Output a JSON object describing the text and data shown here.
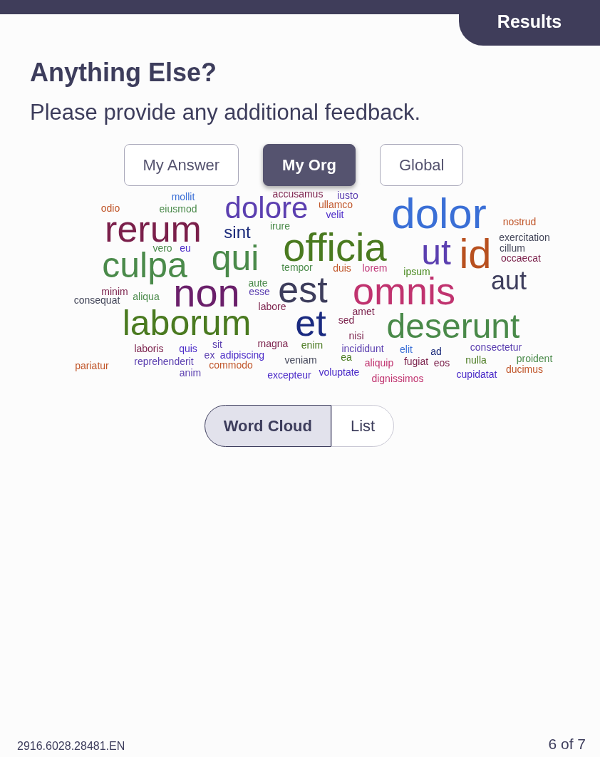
{
  "header": {
    "tab": "Results"
  },
  "title": "Anything Else?",
  "prompt": "Please provide any additional feedback.",
  "scope_buttons": [
    {
      "label": "My Answer",
      "selected": false
    },
    {
      "label": "My Org",
      "selected": true
    },
    {
      "label": "Global",
      "selected": false
    }
  ],
  "word_cloud": [
    {
      "text": "mollit",
      "color": "#3a6fd6"
    },
    {
      "text": "odio",
      "color": "#c0562a"
    },
    {
      "text": "eiusmod",
      "color": "#4a8a4a"
    },
    {
      "text": "dolore",
      "color": "#5b3fb0"
    },
    {
      "text": "accusamus",
      "color": "#7a1f4a"
    },
    {
      "text": "iusto",
      "color": "#5b3fb0"
    },
    {
      "text": "ullamco",
      "color": "#c0562a"
    },
    {
      "text": "velit",
      "color": "#4a2ac8"
    },
    {
      "text": "rerum",
      "color": "#7a1f4a"
    },
    {
      "text": "vero",
      "color": "#4a8a4a"
    },
    {
      "text": "eu",
      "color": "#4a2ac8"
    },
    {
      "text": "sint",
      "color": "#1a2a7a"
    },
    {
      "text": "irure",
      "color": "#4a8a4a"
    },
    {
      "text": "officia",
      "color": "#4a7a20"
    },
    {
      "text": "dolor",
      "color": "#3a6fd6"
    },
    {
      "text": "ut",
      "color": "#5b3fb0"
    },
    {
      "text": "id",
      "color": "#b8501f"
    },
    {
      "text": "nostrud",
      "color": "#c0562a"
    },
    {
      "text": "exercitation",
      "color": "#44475a"
    },
    {
      "text": "cillum",
      "color": "#44475a"
    },
    {
      "text": "culpa",
      "color": "#4a8a4a"
    },
    {
      "text": "qui",
      "color": "#4a8a4a"
    },
    {
      "text": "tempor",
      "color": "#4a8a4a"
    },
    {
      "text": "duis",
      "color": "#c0562a"
    },
    {
      "text": "lorem",
      "color": "#c03a7a"
    },
    {
      "text": "ipsum",
      "color": "#4a8a20"
    },
    {
      "text": "occaecat",
      "color": "#7a1f4a"
    },
    {
      "text": "aut",
      "color": "#3d3d5c"
    },
    {
      "text": "minim",
      "color": "#7a1f4a"
    },
    {
      "text": "consequat",
      "color": "#44475a"
    },
    {
      "text": "aliqua",
      "color": "#4a8a4a"
    },
    {
      "text": "non",
      "color": "#6a1f6a"
    },
    {
      "text": "aute",
      "color": "#4a8a4a"
    },
    {
      "text": "esse",
      "color": "#5b3fb0"
    },
    {
      "text": "est",
      "color": "#3d3d5c"
    },
    {
      "text": "omnis",
      "color": "#c0336f"
    },
    {
      "text": "laborum",
      "color": "#4a7a20"
    },
    {
      "text": "labore",
      "color": "#7a1f4a"
    },
    {
      "text": "et",
      "color": "#1a2a80"
    },
    {
      "text": "amet",
      "color": "#7a1f4a"
    },
    {
      "text": "sed",
      "color": "#7a1f4a"
    },
    {
      "text": "nisi",
      "color": "#7a1f4a"
    },
    {
      "text": "deserunt",
      "color": "#4a8a4a"
    },
    {
      "text": "laboris",
      "color": "#7a1f4a"
    },
    {
      "text": "quis",
      "color": "#4a2ac8"
    },
    {
      "text": "sit",
      "color": "#5b3fb0"
    },
    {
      "text": "magna",
      "color": "#7a1f4a"
    },
    {
      "text": "enim",
      "color": "#4a7a20"
    },
    {
      "text": "incididunt",
      "color": "#5b3fb0"
    },
    {
      "text": "elit",
      "color": "#3a6fd6"
    },
    {
      "text": "ad",
      "color": "#1a2a7a"
    },
    {
      "text": "consectetur",
      "color": "#5b3fb0"
    },
    {
      "text": "reprehenderit",
      "color": "#5b3fb0"
    },
    {
      "text": "ex",
      "color": "#5b3fb0"
    },
    {
      "text": "adipiscing",
      "color": "#4a2ac8"
    },
    {
      "text": "veniam",
      "color": "#44475a"
    },
    {
      "text": "ea",
      "color": "#4a7a20"
    },
    {
      "text": "aliquip",
      "color": "#c0336f"
    },
    {
      "text": "fugiat",
      "color": "#7a1f4a"
    },
    {
      "text": "eos",
      "color": "#7a1f4a"
    },
    {
      "text": "nulla",
      "color": "#4a7a20"
    },
    {
      "text": "proident",
      "color": "#4a8a4a"
    },
    {
      "text": "pariatur",
      "color": "#c0562a"
    },
    {
      "text": "anim",
      "color": "#5b3fb0"
    },
    {
      "text": "commodo",
      "color": "#c0562a"
    },
    {
      "text": "excepteur",
      "color": "#4a2ac8"
    },
    {
      "text": "voluptate",
      "color": "#4a2ac8"
    },
    {
      "text": "dignissimos",
      "color": "#c0336f"
    },
    {
      "text": "cupidatat",
      "color": "#4a2ac8"
    },
    {
      "text": "ducimus",
      "color": "#c0562a"
    }
  ],
  "view_toggle": [
    {
      "label": "Word Cloud",
      "selected": true
    },
    {
      "label": "List",
      "selected": false
    }
  ],
  "footer": {
    "code": "2916.6028.28481.EN",
    "progress": "6 of 7"
  }
}
